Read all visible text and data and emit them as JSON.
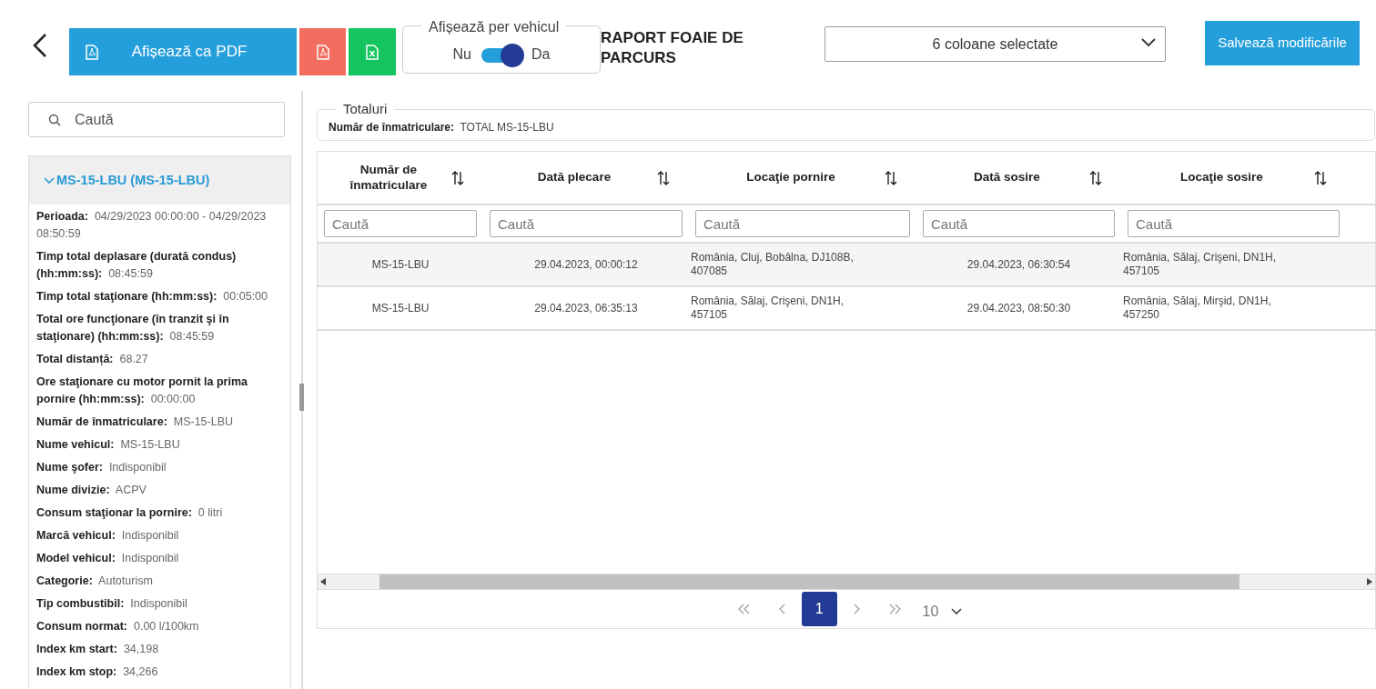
{
  "header": {
    "pdf_button": "Afișează ca PDF",
    "toggle": {
      "label": "Afișează per vehicul",
      "off_label": "Nu",
      "on_label": "Da",
      "on": true
    },
    "title": "RAPORT FOAIE DE PARCURS",
    "columns_select": "6 coloane selectate",
    "save_button": "Salvează modificările"
  },
  "sidebar": {
    "search_placeholder": "Caută",
    "vehicle": {
      "title": "MS-15-LBU (MS-15-LBU)",
      "expanded": true,
      "fields": [
        {
          "label": "Perioada:",
          "value": "04/29/2023 00:00:00 - 04/29/2023 08:50:59"
        },
        {
          "label": "Timp total deplasare (durată condus) (hh:mm:ss):",
          "value": "08:45:59"
        },
        {
          "label": "Timp total staţionare (hh:mm:ss):",
          "value": "00:05:00"
        },
        {
          "label": "Total ore funcţionare (în tranzit şi în staţionare) (hh:mm:ss):",
          "value": "08:45:59"
        },
        {
          "label": "Total distanță:",
          "value": "68.27"
        },
        {
          "label": "Ore staţionare cu motor pornit la prima pornire (hh:mm:ss):",
          "value": "00:00:00"
        },
        {
          "label": "Număr de înmatriculare:",
          "value": "MS-15-LBU"
        },
        {
          "label": "Nume vehicul:",
          "value": "MS-15-LBU"
        },
        {
          "label": "Nume şofer:",
          "value": "Indisponibil"
        },
        {
          "label": "Nume divizie:",
          "value": "ACPV"
        },
        {
          "label": "Consum staţionar la pornire:",
          "value": "0 litri"
        },
        {
          "label": "Marcă vehicul:",
          "value": "Indisponibil"
        },
        {
          "label": "Model vehicul:",
          "value": "Indisponibil"
        },
        {
          "label": "Categorie:",
          "value": "Autoturism"
        },
        {
          "label": "Tip combustibil:",
          "value": "Indisponibil"
        },
        {
          "label": "Consum normat:",
          "value": "0.00 l/100km"
        },
        {
          "label": "Index km start:",
          "value": "34,198"
        },
        {
          "label": "Index km stop:",
          "value": "34,266"
        }
      ]
    }
  },
  "totals": {
    "legend": "Totaluri",
    "fields": [
      {
        "label": "Număr de înmatriculare:",
        "value": "TOTAL MS-15-LBU"
      }
    ]
  },
  "table": {
    "columns": [
      {
        "label": "Număr de înmatriculare",
        "filter_placeholder": "Caută"
      },
      {
        "label": "Dată plecare",
        "filter_placeholder": "Caută"
      },
      {
        "label": "Locaţie pornire",
        "filter_placeholder": "Caută"
      },
      {
        "label": "Dată sosire",
        "filter_placeholder": "Caută"
      },
      {
        "label": "Locaţie sosire",
        "filter_placeholder": "Caută"
      }
    ],
    "rows": [
      {
        "cells": [
          "MS-15-LBU",
          "29.04.2023, 00:00:12",
          "România, Cluj, Bobâlna, DJ108B, 407085",
          "29.04.2023, 06:30:54",
          "România, Sălaj, Crişeni, DN1H, 457105"
        ]
      },
      {
        "cells": [
          "MS-15-LBU",
          "29.04.2023, 06:35:13",
          "România, Sălaj, Crişeni, DN1H, 457105",
          "29.04.2023, 08:50:30",
          "România, Sălaj, Mirşid, DN1H, 457250"
        ]
      }
    ]
  },
  "pagination": {
    "pages": [
      {
        "label": "1",
        "selected": true
      }
    ],
    "page_size": "10"
  }
}
